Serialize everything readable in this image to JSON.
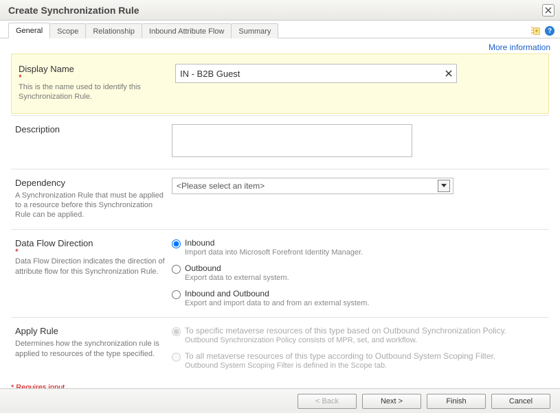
{
  "window": {
    "title": "Create Synchronization Rule"
  },
  "tabs": {
    "general": "General",
    "scope": "Scope",
    "relationship": "Relationship",
    "inbound": "Inbound Attribute Flow",
    "summary": "Summary"
  },
  "links": {
    "more_info": "More information"
  },
  "fields": {
    "display_name": {
      "label": "Display Name",
      "help": "This is the name used to identify this Synchronization Rule.",
      "value": "IN - B2B Guest"
    },
    "description": {
      "label": "Description",
      "value": ""
    },
    "dependency": {
      "label": "Dependency",
      "help": "A Synchronization Rule that must be applied to a resource before this Synchronization Rule can be applied.",
      "placeholder": "<Please select an item>"
    },
    "direction": {
      "label": "Data Flow Direction",
      "help": "Data Flow Direction indicates the direction of attribute flow for this Synchronization Rule.",
      "options": {
        "inbound": {
          "label": "Inbound",
          "sub": "Import data into Microsoft Forefront Identity Manager."
        },
        "outbound": {
          "label": "Outbound",
          "sub": "Export data to external system."
        },
        "both": {
          "label": "Inbound and Outbound",
          "sub": "Export and import data to and from an external system."
        }
      },
      "selected": "inbound"
    },
    "apply_rule": {
      "label": "Apply Rule",
      "help": "Determines how the synchronization rule is applied to resources of the type specified.",
      "options": {
        "policy": {
          "label": "To specific metaverse resources of this type based on Outbound Synchronization Policy.",
          "sub": "Outbound Synchronization Policy consists of MPR, set, and workflow."
        },
        "filter": {
          "label": "To all metaverse resources of this type according to Outbound System Scoping Filter.",
          "sub": "Outbound System Scoping Filter is defined in the Scope tab."
        }
      }
    }
  },
  "notes": {
    "requires": "* Requires input"
  },
  "buttons": {
    "back": "< Back",
    "next": "Next >",
    "finish": "Finish",
    "cancel": "Cancel"
  }
}
